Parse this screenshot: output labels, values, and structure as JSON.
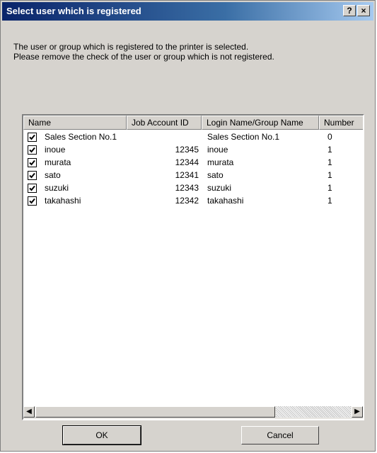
{
  "window": {
    "title": "Select user which is registered",
    "help_label": "?",
    "close_label": "×"
  },
  "description": {
    "line1": "The user or group which is registered to the printer is selected.",
    "line2": "Please remove the check of the user or group which is not registered."
  },
  "list": {
    "columns": [
      "Name",
      "Job Account ID",
      "Login Name/Group Name",
      "Number"
    ],
    "rows": [
      {
        "checked": true,
        "name": "Sales Section No.1",
        "job_account_id": "",
        "login": "Sales Section No.1",
        "number": "0"
      },
      {
        "checked": true,
        "name": "inoue",
        "job_account_id": "12345",
        "login": "inoue",
        "number": "1"
      },
      {
        "checked": true,
        "name": "murata",
        "job_account_id": "12344",
        "login": "murata",
        "number": "1"
      },
      {
        "checked": true,
        "name": "sato",
        "job_account_id": "12341",
        "login": "sato",
        "number": "1"
      },
      {
        "checked": true,
        "name": "suzuki",
        "job_account_id": "12343",
        "login": "suzuki",
        "number": "1"
      },
      {
        "checked": true,
        "name": "takahashi",
        "job_account_id": "12342",
        "login": "takahashi",
        "number": "1"
      }
    ],
    "scroll_left_label": "◀",
    "scroll_right_label": "▶"
  },
  "buttons": {
    "ok": "OK",
    "cancel": "Cancel"
  }
}
